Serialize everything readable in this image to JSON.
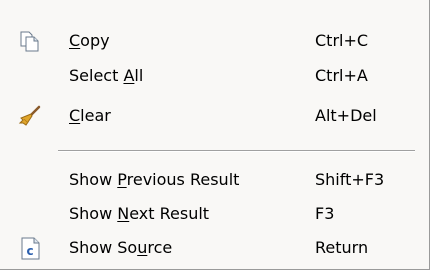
{
  "menu": {
    "items": [
      {
        "pre": "",
        "mn": "C",
        "post": "opy",
        "shortcut": "Ctrl+C",
        "icon": "copy-icon"
      },
      {
        "pre": "Select ",
        "mn": "A",
        "post": "ll",
        "shortcut": "Ctrl+A",
        "icon": ""
      },
      {
        "pre": "",
        "mn": "C",
        "post": "lear",
        "shortcut": "Alt+Del",
        "icon": "broom-icon"
      },
      {
        "pre": "Show ",
        "mn": "P",
        "post": "revious Result",
        "shortcut": "Shift+F3",
        "icon": ""
      },
      {
        "pre": "Show ",
        "mn": "N",
        "post": "ext Result",
        "shortcut": "F3",
        "icon": ""
      },
      {
        "pre": "Show So",
        "mn": "u",
        "post": "rce",
        "shortcut": "Return",
        "icon": "source-file-icon"
      }
    ]
  },
  "colors": {
    "background": "#f9f8f6",
    "separator": "#a0a0a0",
    "text": "#000000"
  }
}
